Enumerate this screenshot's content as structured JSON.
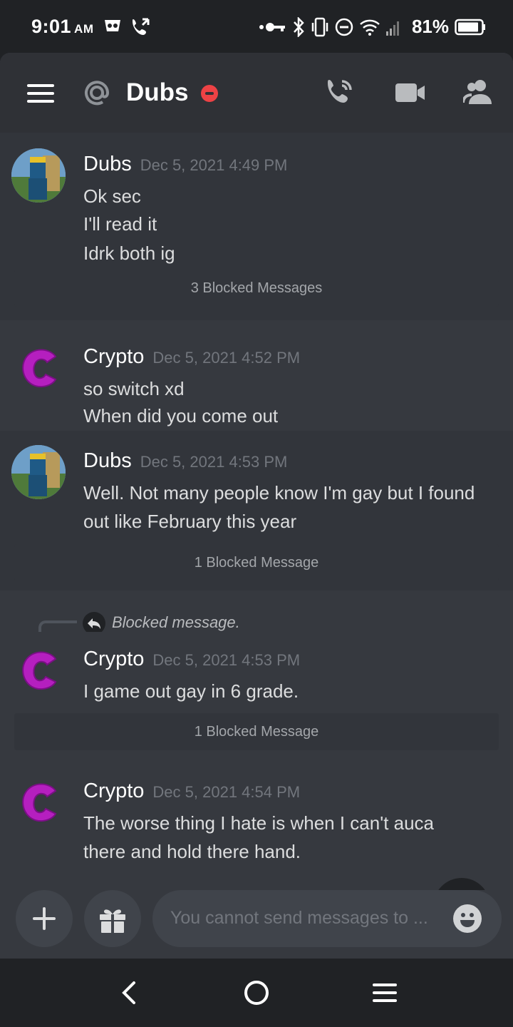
{
  "status_bar": {
    "time": "9:01",
    "ampm": "AM",
    "battery_percent": "81%",
    "icons": [
      "shield-app-icon",
      "wifi-calling-icon",
      "vpn-key-icon",
      "bluetooth-icon",
      "vibrate-icon",
      "dnd-icon",
      "wifi-icon",
      "signal-icon",
      "battery-icon"
    ]
  },
  "header": {
    "channel_title": "Dubs",
    "status": "do-not-disturb",
    "icons": [
      "menu-icon",
      "at-icon",
      "voice-call-icon",
      "video-call-icon",
      "members-icon"
    ]
  },
  "messages": [
    {
      "author": "Dubs",
      "timestamp": "Dec 5, 2021 4:49 PM",
      "lines": [
        "Ok sec",
        "I'll read it",
        "Idrk both ig"
      ]
    },
    {
      "blocked": "3 Blocked Messages"
    },
    {
      "author": "Crypto",
      "timestamp": "Dec 5, 2021 4:52 PM",
      "lines": [
        "so switch xd",
        "When did you come out"
      ]
    },
    {
      "author": "Dubs",
      "timestamp": "Dec 5, 2021 4:53 PM",
      "lines": [
        "Well. Not many people know I'm gay but I found",
        "out like February this year"
      ]
    },
    {
      "blocked": "1 Blocked Message"
    },
    {
      "reply_to": "Blocked message.",
      "author": "Crypto",
      "timestamp": "Dec 5, 2021 4:53 PM",
      "lines": [
        "I game out gay in 6 grade."
      ]
    },
    {
      "blocked": "1 Blocked Message"
    },
    {
      "author": "Crypto",
      "timestamp": "Dec 5, 2021 4:54 PM",
      "lines": [
        "The worse thing I hate is when I can't auca",
        "there and hold there hand."
      ]
    }
  ],
  "composer": {
    "placeholder": "You cannot send messages to ..."
  },
  "colors": {
    "background": "#36393f",
    "header": "#2f3136",
    "dnd": "#ed4245",
    "crypto_avatar": "#b51fbf"
  }
}
